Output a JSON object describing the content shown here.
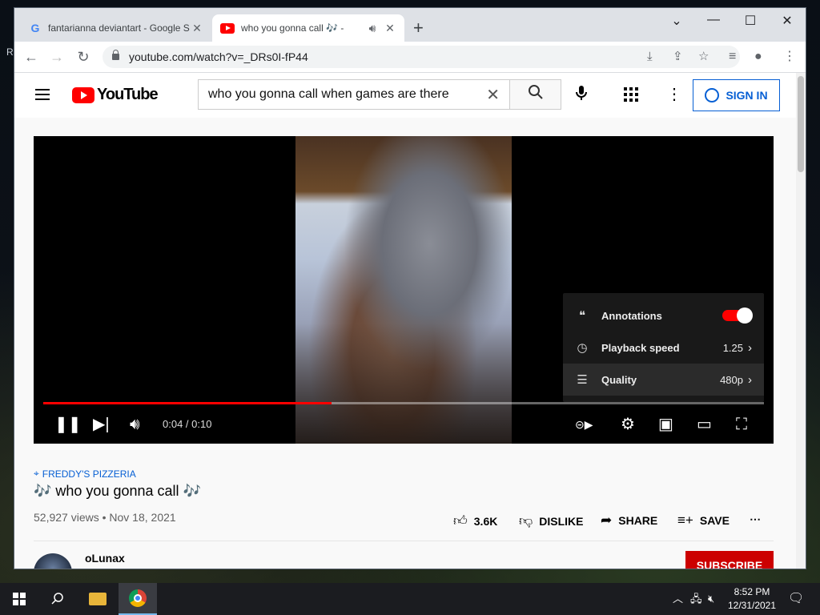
{
  "desktop": {
    "edge_text": "R"
  },
  "browser": {
    "tabs": [
      {
        "title": "fantarianna deviantart - Google S",
        "favicon": "google-g-icon",
        "active": false
      },
      {
        "title": "who you gonna call 🎶 -",
        "favicon": "youtube-icon",
        "active": true
      }
    ],
    "url": "youtube.com/watch?v=_DRs0I-fP44"
  },
  "youtube": {
    "logo_text": "YouTube",
    "search": {
      "value": "who you gonna call when games are there"
    },
    "sign_in_label": "SIGN IN",
    "player": {
      "time": "0:04 / 0:10",
      "progress": 0.4,
      "settings_menu": [
        {
          "label": "Annotations",
          "value": "",
          "icon": "annotations-icon",
          "toggle_on": true
        },
        {
          "label": "Playback speed",
          "value": "1.25",
          "icon": "playback-speed-icon"
        },
        {
          "label": "Quality",
          "value": "480p",
          "icon": "quality-sliders-icon"
        }
      ]
    },
    "video": {
      "location": "FREDDY'S PIZZERIA",
      "title": "🎶 who you gonna call 🎶",
      "meta": "52,927 views • Nov 18, 2021",
      "likes": "3.6K",
      "dislike_label": "DISLIKE",
      "share_label": "SHARE",
      "save_label": "SAVE"
    },
    "channel": {
      "name": "oLunax",
      "subscribe_label": "SUBSCRIBE"
    }
  },
  "taskbar": {
    "time": "8:52 PM",
    "date": "12/31/2021"
  },
  "colors": {
    "youtube_red": "#ff0000",
    "link_blue": "#065fd4",
    "subscribe_red": "#cc0000"
  }
}
